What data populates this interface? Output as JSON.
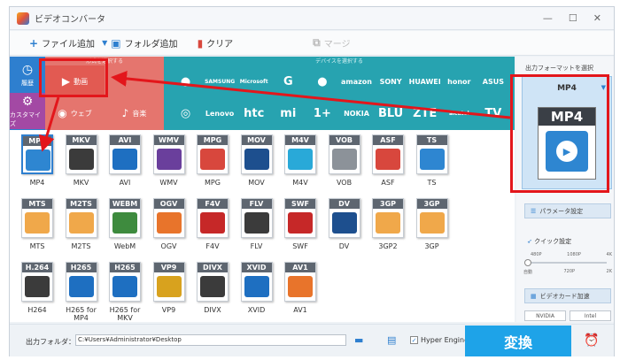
{
  "window": {
    "title": "ビデオコンバータ",
    "min": "—",
    "max": "☐",
    "close": "✕"
  },
  "toolbar": {
    "add_file": "ファイル追加",
    "add_folder": "フォルダ追加",
    "clear": "クリア",
    "merge": "マージ"
  },
  "categories": {
    "history": "履歴",
    "customize": "カスタマイズ",
    "format_header": "形式を選択する",
    "device_header": "デバイスを選択する",
    "video": "動画",
    "web": "ウェブ",
    "music": "音楽"
  },
  "brands_row1": [
    "",
    "SAMSUNG",
    "Microsoft",
    "G",
    "",
    "amazon",
    "SONY",
    "HUAWEI",
    "honor",
    "ASUS"
  ],
  "brands_row2": [
    "",
    "Lenovo",
    "htc",
    "mi",
    "1+",
    "NOKIA",
    "BLU",
    "ZTE",
    "alcatel",
    "TV"
  ],
  "formats": [
    {
      "tag": "MP4",
      "label": "MP4",
      "color": "#2e86d1"
    },
    {
      "tag": "MKV",
      "label": "MKV",
      "color": "#3b3b3b"
    },
    {
      "tag": "AVI",
      "label": "AVI",
      "color": "#1e6fc1"
    },
    {
      "tag": "WMV",
      "label": "WMV",
      "color": "#6a3f9c"
    },
    {
      "tag": "MPG",
      "label": "MPG",
      "color": "#d8473d"
    },
    {
      "tag": "MOV",
      "label": "MOV",
      "color": "#1d4f8e"
    },
    {
      "tag": "M4V",
      "label": "M4V",
      "color": "#29a9d8"
    },
    {
      "tag": "VOB",
      "label": "VOB",
      "color": "#8c9299"
    },
    {
      "tag": "ASF",
      "label": "ASF",
      "color": "#d8473d"
    },
    {
      "tag": "TS",
      "label": "TS",
      "color": "#2e86d1"
    },
    {
      "tag": "MTS",
      "label": "MTS",
      "color": "#f0a84a"
    },
    {
      "tag": "M2TS",
      "label": "M2TS",
      "color": "#f0a84a"
    },
    {
      "tag": "WEBM",
      "label": "WebM",
      "color": "#3e8b3e"
    },
    {
      "tag": "OGV",
      "label": "OGV",
      "color": "#e8742b"
    },
    {
      "tag": "F4V",
      "label": "F4V",
      "color": "#c62828"
    },
    {
      "tag": "FLV",
      "label": "FLV",
      "color": "#3b3b3b"
    },
    {
      "tag": "SWF",
      "label": "SWF",
      "color": "#c62828"
    },
    {
      "tag": "DV",
      "label": "DV",
      "color": "#1d4f8e"
    },
    {
      "tag": "3GP",
      "label": "3GP2",
      "color": "#f0a84a"
    },
    {
      "tag": "3GP",
      "label": "3GP",
      "color": "#f0a84a"
    },
    {
      "tag": "H.264",
      "label": "H264",
      "color": "#3b3b3b"
    },
    {
      "tag": "H265",
      "label": "H265 for MP4",
      "color": "#1e6fc1"
    },
    {
      "tag": "H265",
      "label": "H265 for MKV",
      "color": "#1e6fc1"
    },
    {
      "tag": "VP9",
      "label": "VP9",
      "color": "#d8a21e"
    },
    {
      "tag": "DIVX",
      "label": "DIVX",
      "color": "#3b3b3b"
    },
    {
      "tag": "XVID",
      "label": "XVID",
      "color": "#1e6fc1"
    },
    {
      "tag": "AV1",
      "label": "AV1",
      "color": "#e8742b"
    }
  ],
  "output": {
    "panel_title": "出力フォーマットを選択",
    "selected": "MP4",
    "dropdown": "▼",
    "params": "パラメータ設定",
    "quick": "クイック設定",
    "q_top": [
      "480P",
      "1080P",
      "4K"
    ],
    "q_bottom": [
      "自動",
      "720P",
      "2K"
    ],
    "gpu": "ビデオカード加速",
    "nvidia": "NVIDIA",
    "intel": "Intel"
  },
  "bottom": {
    "folder_label": "出力フォルダ：",
    "path": "C:¥Users¥Administrator¥Desktop",
    "hyper": "Hyper Engine",
    "convert": "変換"
  },
  "colors": {
    "highlight": "#e3161b",
    "accent": "#1ea3e8"
  }
}
